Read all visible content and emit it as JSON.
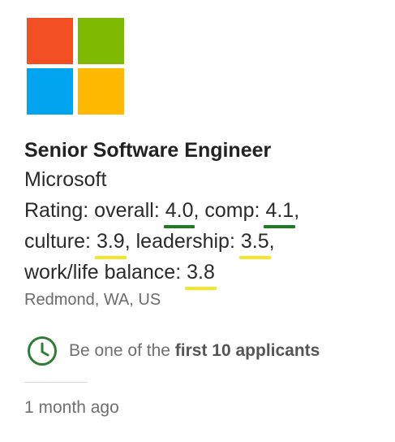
{
  "company_logo": {
    "name": "Microsoft",
    "colors": {
      "red": "#f25022",
      "green": "#7fba00",
      "blue": "#00a4ef",
      "yellow": "#ffb900"
    }
  },
  "job": {
    "title": "Senior Software Engineer",
    "company": "Microsoft",
    "location": "Redmond, WA, US"
  },
  "ratings": {
    "prefix": "Rating:",
    "items": [
      {
        "label": "overall:",
        "value": "4.0",
        "color": "#1e7d22"
      },
      {
        "label": "comp:",
        "value": "4.1",
        "color": "#1e7d22"
      },
      {
        "label": "culture:",
        "value": "3.9",
        "color": "#f5e62a"
      },
      {
        "label": "leadership:",
        "value": "3.5",
        "color": "#f5e62a"
      },
      {
        "label": "work/life balance:",
        "value": "3.8",
        "color": "#f5e62a"
      }
    ]
  },
  "applicants": {
    "prefix": "Be one of the",
    "emphasis": "first 10 applicants",
    "icon": "clock-icon",
    "icon_color": "#2e7d32"
  },
  "posted": "1 month ago"
}
